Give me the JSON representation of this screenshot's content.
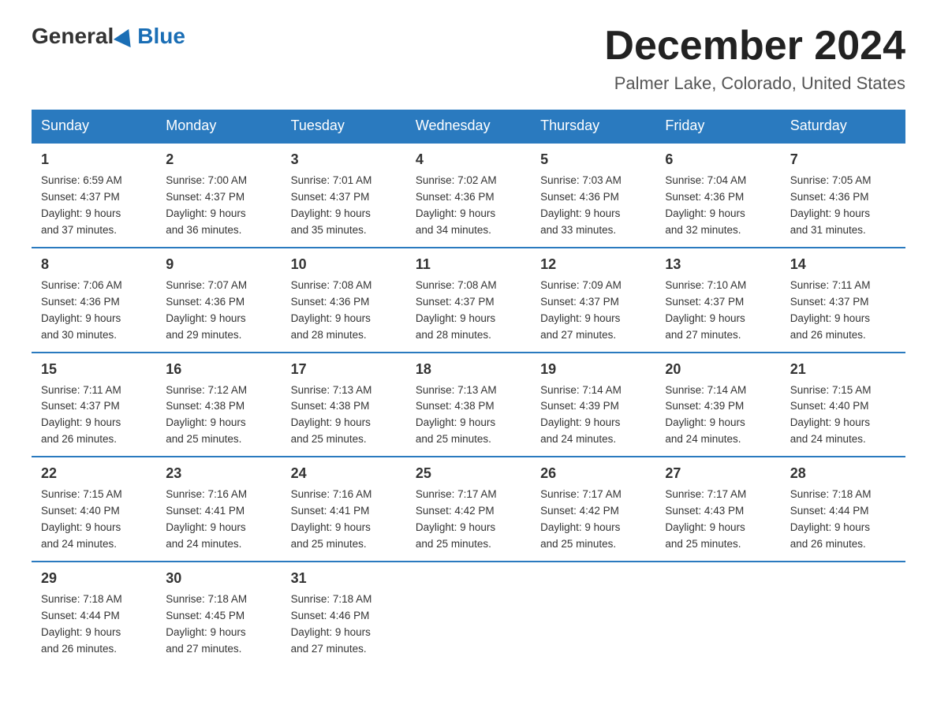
{
  "header": {
    "logo_general": "General",
    "logo_blue": "Blue",
    "title": "December 2024",
    "location": "Palmer Lake, Colorado, United States"
  },
  "days_of_week": [
    "Sunday",
    "Monday",
    "Tuesday",
    "Wednesday",
    "Thursday",
    "Friday",
    "Saturday"
  ],
  "weeks": [
    [
      {
        "day": "1",
        "sunrise": "6:59 AM",
        "sunset": "4:37 PM",
        "daylight": "9 hours and 37 minutes."
      },
      {
        "day": "2",
        "sunrise": "7:00 AM",
        "sunset": "4:37 PM",
        "daylight": "9 hours and 36 minutes."
      },
      {
        "day": "3",
        "sunrise": "7:01 AM",
        "sunset": "4:37 PM",
        "daylight": "9 hours and 35 minutes."
      },
      {
        "day": "4",
        "sunrise": "7:02 AM",
        "sunset": "4:36 PM",
        "daylight": "9 hours and 34 minutes."
      },
      {
        "day": "5",
        "sunrise": "7:03 AM",
        "sunset": "4:36 PM",
        "daylight": "9 hours and 33 minutes."
      },
      {
        "day": "6",
        "sunrise": "7:04 AM",
        "sunset": "4:36 PM",
        "daylight": "9 hours and 32 minutes."
      },
      {
        "day": "7",
        "sunrise": "7:05 AM",
        "sunset": "4:36 PM",
        "daylight": "9 hours and 31 minutes."
      }
    ],
    [
      {
        "day": "8",
        "sunrise": "7:06 AM",
        "sunset": "4:36 PM",
        "daylight": "9 hours and 30 minutes."
      },
      {
        "day": "9",
        "sunrise": "7:07 AM",
        "sunset": "4:36 PM",
        "daylight": "9 hours and 29 minutes."
      },
      {
        "day": "10",
        "sunrise": "7:08 AM",
        "sunset": "4:36 PM",
        "daylight": "9 hours and 28 minutes."
      },
      {
        "day": "11",
        "sunrise": "7:08 AM",
        "sunset": "4:37 PM",
        "daylight": "9 hours and 28 minutes."
      },
      {
        "day": "12",
        "sunrise": "7:09 AM",
        "sunset": "4:37 PM",
        "daylight": "9 hours and 27 minutes."
      },
      {
        "day": "13",
        "sunrise": "7:10 AM",
        "sunset": "4:37 PM",
        "daylight": "9 hours and 27 minutes."
      },
      {
        "day": "14",
        "sunrise": "7:11 AM",
        "sunset": "4:37 PM",
        "daylight": "9 hours and 26 minutes."
      }
    ],
    [
      {
        "day": "15",
        "sunrise": "7:11 AM",
        "sunset": "4:37 PM",
        "daylight": "9 hours and 26 minutes."
      },
      {
        "day": "16",
        "sunrise": "7:12 AM",
        "sunset": "4:38 PM",
        "daylight": "9 hours and 25 minutes."
      },
      {
        "day": "17",
        "sunrise": "7:13 AM",
        "sunset": "4:38 PM",
        "daylight": "9 hours and 25 minutes."
      },
      {
        "day": "18",
        "sunrise": "7:13 AM",
        "sunset": "4:38 PM",
        "daylight": "9 hours and 25 minutes."
      },
      {
        "day": "19",
        "sunrise": "7:14 AM",
        "sunset": "4:39 PM",
        "daylight": "9 hours and 24 minutes."
      },
      {
        "day": "20",
        "sunrise": "7:14 AM",
        "sunset": "4:39 PM",
        "daylight": "9 hours and 24 minutes."
      },
      {
        "day": "21",
        "sunrise": "7:15 AM",
        "sunset": "4:40 PM",
        "daylight": "9 hours and 24 minutes."
      }
    ],
    [
      {
        "day": "22",
        "sunrise": "7:15 AM",
        "sunset": "4:40 PM",
        "daylight": "9 hours and 24 minutes."
      },
      {
        "day": "23",
        "sunrise": "7:16 AM",
        "sunset": "4:41 PM",
        "daylight": "9 hours and 24 minutes."
      },
      {
        "day": "24",
        "sunrise": "7:16 AM",
        "sunset": "4:41 PM",
        "daylight": "9 hours and 25 minutes."
      },
      {
        "day": "25",
        "sunrise": "7:17 AM",
        "sunset": "4:42 PM",
        "daylight": "9 hours and 25 minutes."
      },
      {
        "day": "26",
        "sunrise": "7:17 AM",
        "sunset": "4:42 PM",
        "daylight": "9 hours and 25 minutes."
      },
      {
        "day": "27",
        "sunrise": "7:17 AM",
        "sunset": "4:43 PM",
        "daylight": "9 hours and 25 minutes."
      },
      {
        "day": "28",
        "sunrise": "7:18 AM",
        "sunset": "4:44 PM",
        "daylight": "9 hours and 26 minutes."
      }
    ],
    [
      {
        "day": "29",
        "sunrise": "7:18 AM",
        "sunset": "4:44 PM",
        "daylight": "9 hours and 26 minutes."
      },
      {
        "day": "30",
        "sunrise": "7:18 AM",
        "sunset": "4:45 PM",
        "daylight": "9 hours and 27 minutes."
      },
      {
        "day": "31",
        "sunrise": "7:18 AM",
        "sunset": "4:46 PM",
        "daylight": "9 hours and 27 minutes."
      },
      null,
      null,
      null,
      null
    ]
  ]
}
